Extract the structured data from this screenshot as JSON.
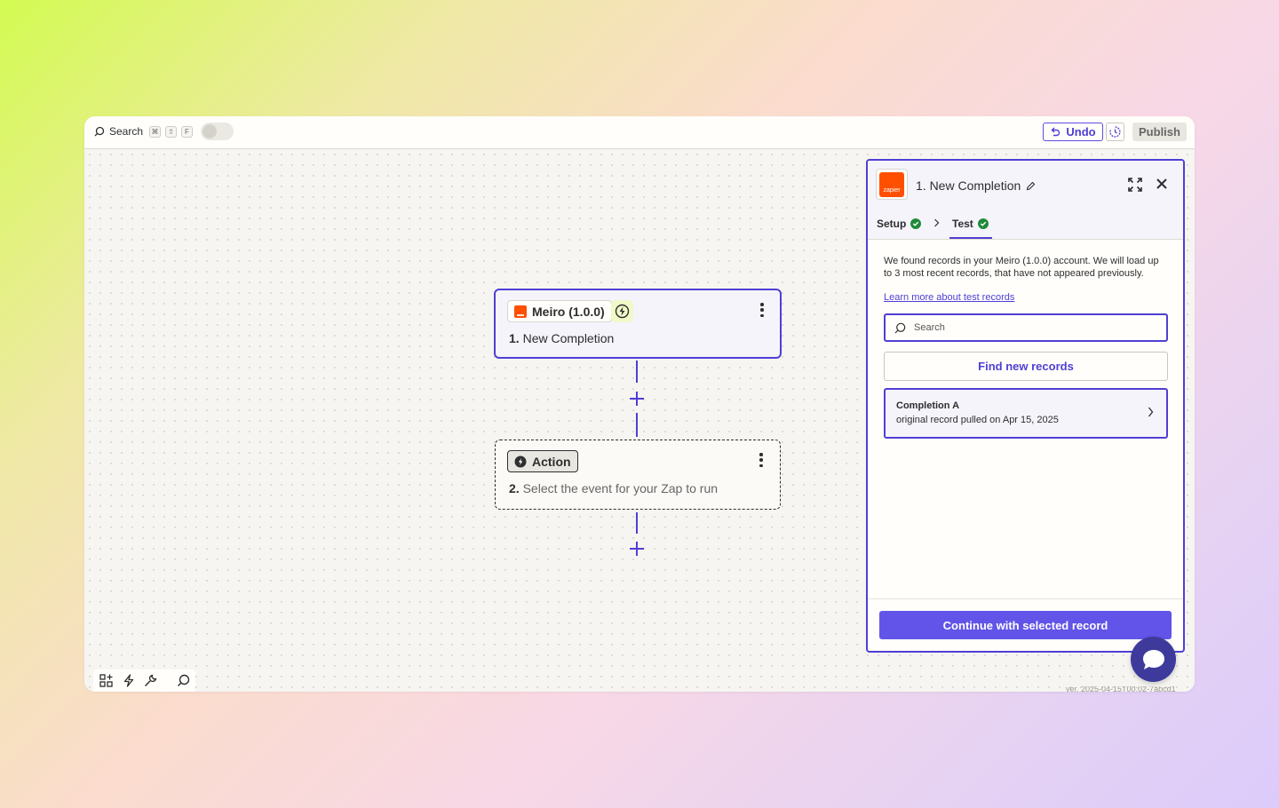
{
  "topbar": {
    "search_label": "Search",
    "shortcut_keys": [
      "⌘",
      "⇧",
      "F"
    ],
    "undo_label": "Undo",
    "publish_label": "Publish"
  },
  "canvas": {
    "trigger": {
      "app_name": "Meiro (1.0.0)",
      "step_number": "1.",
      "step_title": "New Completion"
    },
    "action": {
      "chip_label": "Action",
      "step_number": "2.",
      "step_title": "Select the event for your Zap to run"
    }
  },
  "panel": {
    "logo_text": "zapier",
    "title": "1. New Completion",
    "tabs": [
      {
        "label": "Setup",
        "complete": true
      },
      {
        "label": "Test",
        "complete": true
      }
    ],
    "description": "We found records in your Meiro (1.0.0) account. We will load up to 3 most recent records, that have not appeared previously.",
    "learn_more_link": "Learn more about test records",
    "search_placeholder": "Search",
    "find_button_label": "Find new records",
    "records": [
      {
        "title": "Completion A",
        "subtitle": "original record pulled on Apr 15, 2025"
      }
    ],
    "continue_button_label": "Continue with selected record"
  },
  "colors": {
    "accent": "#4f3fd4",
    "primary_button": "#6254e8",
    "zapier_orange": "#ff4f00",
    "success_green": "#1f8a3a",
    "chat_button": "#3d3a9c"
  },
  "version_text": "ver. 2025-04-15T00:02-7abcd1"
}
